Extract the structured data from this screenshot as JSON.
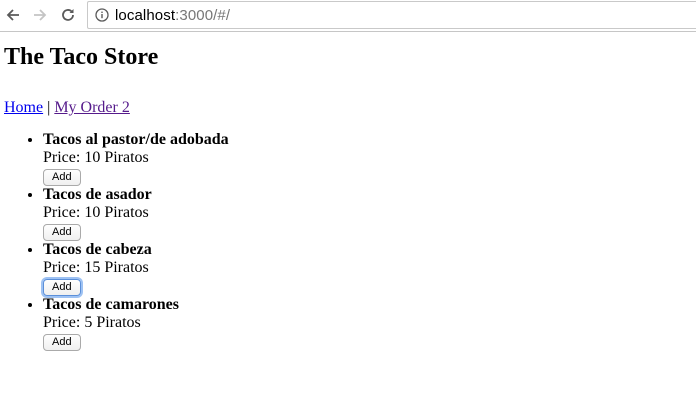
{
  "browser": {
    "url_host": "localhost",
    "url_path": ":3000/#/"
  },
  "page": {
    "title": "The Taco Store",
    "nav": {
      "home_label": "Home",
      "separator": " | ",
      "order_label": "My Order 2"
    },
    "tacos": [
      {
        "name": "Tacos al pastor/de adobada",
        "price": "Price: 10 Piratos",
        "button": "Add"
      },
      {
        "name": "Tacos de asador",
        "price": "Price: 10 Piratos",
        "button": "Add"
      },
      {
        "name": "Tacos de cabeza",
        "price": "Price: 15 Piratos",
        "button": "Add"
      },
      {
        "name": "Tacos de camarones",
        "price": "Price: 5 Piratos",
        "button": "Add"
      }
    ]
  },
  "icons": {
    "back": "back-arrow-icon",
    "forward": "forward-arrow-icon",
    "reload": "reload-icon",
    "info": "info-icon"
  }
}
